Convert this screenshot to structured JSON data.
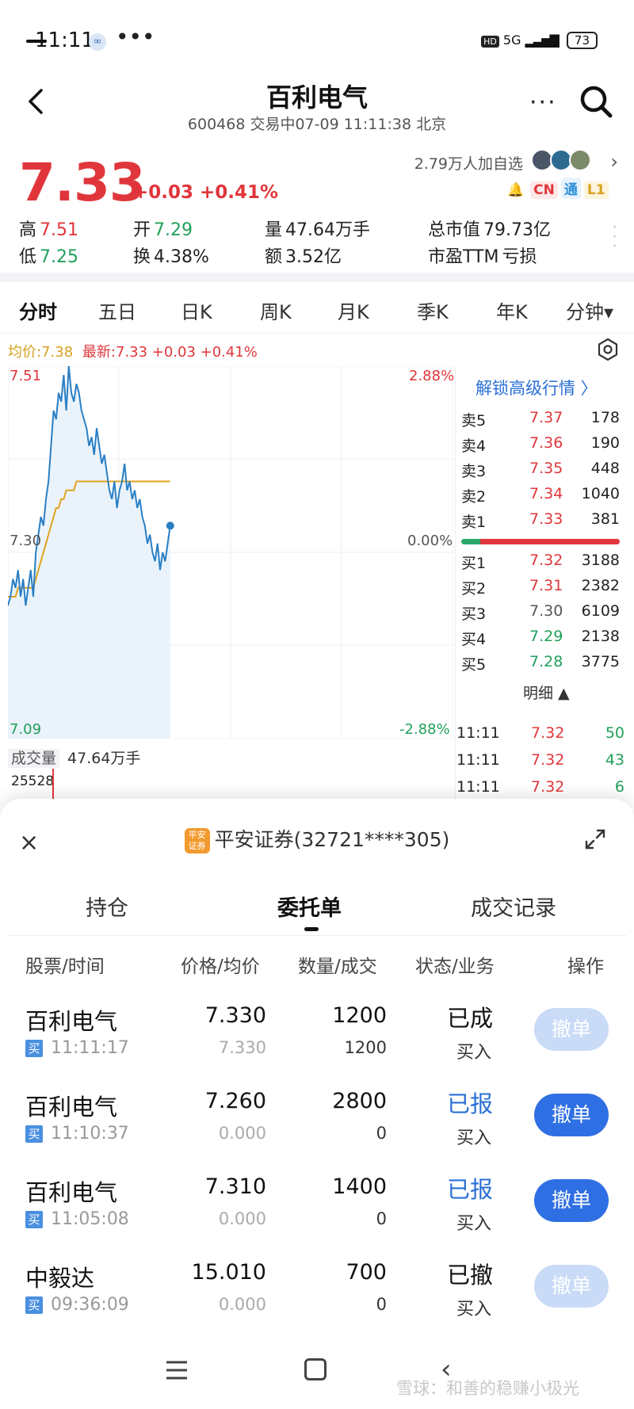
{
  "status_bar": {
    "time": "11:11",
    "more": "•••",
    "network": "5G",
    "battery": "73"
  },
  "header": {
    "title": "百利电气",
    "subtitle": "600468 交易中07-09 11:11:38 北京",
    "more_label": "···"
  },
  "quote": {
    "price": "7.33",
    "change": "+0.03 +0.41%",
    "followers": "2.79万人加自选",
    "tags": [
      "CN",
      "通",
      "L1"
    ],
    "stats": [
      {
        "label": "高",
        "value": "7.51",
        "color": "red"
      },
      {
        "label": "开",
        "value": "7.29",
        "color": "green"
      },
      {
        "label": "量",
        "value": "47.64万手",
        "color": "plain"
      },
      {
        "label": "总市值",
        "value": "79.73亿",
        "color": "plain"
      },
      {
        "label": "低",
        "value": "7.25",
        "color": "green"
      },
      {
        "label": "换",
        "value": "4.38%",
        "color": "plain"
      },
      {
        "label": "额",
        "value": "3.52亿",
        "color": "plain"
      },
      {
        "label": "市盈TTM",
        "value": "亏损",
        "color": "plain"
      }
    ]
  },
  "kline_tabs": [
    "分时",
    "五日",
    "日K",
    "周K",
    "月K",
    "季K",
    "年K",
    "分钟▾"
  ],
  "chart": {
    "avg_label": "均价:7.38",
    "latest_label": "最新:7.33 +0.03 +0.41%",
    "y_high": "7.51",
    "y_mid": "7.30",
    "y_low": "7.09",
    "pct_high": "2.88%",
    "pct_mid": "0.00%",
    "pct_low": "-2.88%",
    "volume_label": "成交量",
    "volume_value": "47.64万手",
    "volume_max": "25528"
  },
  "chart_data": {
    "type": "line",
    "series": [
      {
        "values": [
          7.24,
          7.25,
          7.27,
          7.26,
          7.28,
          7.25,
          7.27,
          7.24,
          7.26,
          7.28,
          7.25,
          7.3,
          7.32,
          7.34,
          7.33,
          7.36,
          7.38,
          7.42,
          7.46,
          7.45,
          7.48,
          7.47,
          7.5,
          7.46,
          7.51,
          7.48,
          7.47,
          7.49,
          7.48,
          7.46,
          7.45,
          7.44,
          7.42,
          7.43,
          7.41,
          7.44,
          7.42,
          7.4,
          7.41,
          7.39,
          7.37,
          7.36,
          7.38,
          7.35,
          7.37,
          7.38,
          7.4,
          7.37,
          7.38,
          7.36,
          7.37,
          7.35,
          7.36,
          7.34,
          7.33,
          7.31,
          7.32,
          7.3,
          7.29,
          7.31,
          7.28,
          7.3,
          7.29,
          7.31,
          7.33
        ]
      },
      {
        "values": [
          7.25,
          7.25,
          7.25,
          7.25,
          7.26,
          7.26,
          7.26,
          7.26,
          7.26,
          7.26,
          7.26,
          7.27,
          7.28,
          7.29,
          7.3,
          7.31,
          7.32,
          7.33,
          7.34,
          7.35,
          7.35,
          7.36,
          7.36,
          7.37,
          7.37,
          7.37,
          7.37,
          7.38,
          7.38,
          7.38,
          7.38,
          7.38,
          7.38,
          7.38,
          7.38,
          7.38,
          7.38,
          7.38,
          7.38,
          7.38,
          7.38,
          7.38,
          7.38,
          7.38,
          7.38,
          7.38,
          7.38,
          7.38,
          7.38,
          7.38,
          7.38,
          7.38,
          7.38,
          7.38,
          7.38,
          7.38,
          7.38,
          7.38,
          7.38,
          7.38,
          7.38,
          7.38,
          7.38,
          7.38,
          7.38
        ]
      }
    ],
    "ylim": [
      7.09,
      7.51
    ],
    "grid": true
  },
  "orderbook": {
    "unlock": "解锁高级行情 〉",
    "asks": [
      {
        "label": "卖5",
        "price": "7.37",
        "qty": "178",
        "color": "red"
      },
      {
        "label": "卖4",
        "price": "7.36",
        "qty": "190",
        "color": "red"
      },
      {
        "label": "卖3",
        "price": "7.35",
        "qty": "448",
        "color": "red"
      },
      {
        "label": "卖2",
        "price": "7.34",
        "qty": "1040",
        "color": "red"
      },
      {
        "label": "卖1",
        "price": "7.33",
        "qty": "381",
        "color": "red"
      }
    ],
    "bids": [
      {
        "label": "买1",
        "price": "7.32",
        "qty": "3188",
        "color": "red"
      },
      {
        "label": "买2",
        "price": "7.31",
        "qty": "2382",
        "color": "red"
      },
      {
        "label": "买3",
        "price": "7.30",
        "qty": "6109",
        "color": "gray"
      },
      {
        "label": "买4",
        "price": "7.29",
        "qty": "2138",
        "color": "green"
      },
      {
        "label": "买5",
        "price": "7.28",
        "qty": "3775",
        "color": "green"
      }
    ],
    "mingxi": "明细 ▲",
    "ticks": [
      {
        "time": "11:11",
        "price": "7.32",
        "qty": "50",
        "color": "green"
      },
      {
        "time": "11:11",
        "price": "7.32",
        "qty": "43",
        "color": "green"
      },
      {
        "time": "11:11",
        "price": "7.32",
        "qty": "6",
        "color": "green"
      }
    ]
  },
  "sheet": {
    "close": "×",
    "broker_logo": "平安证券",
    "broker": "平安证券(32721****305)",
    "tabs": [
      "持仓",
      "委托单",
      "成交记录"
    ],
    "columns": [
      "股票/时间",
      "价格/均价",
      "数量/成交",
      "状态/业务",
      "操作"
    ],
    "orders": [
      {
        "name": "百利电气",
        "side": "买",
        "time": "11:11:17",
        "price": "7.330",
        "avg": "7.330",
        "qty": "1200",
        "filled": "1200",
        "status": "已成",
        "status_style": "plain",
        "biz": "买入",
        "action": "撤单",
        "enabled": false
      },
      {
        "name": "百利电气",
        "side": "买",
        "time": "11:10:37",
        "price": "7.260",
        "avg": "0.000",
        "qty": "2800",
        "filled": "0",
        "status": "已报",
        "status_style": "blue",
        "biz": "买入",
        "action": "撤单",
        "enabled": true
      },
      {
        "name": "百利电气",
        "side": "买",
        "time": "11:05:08",
        "price": "7.310",
        "avg": "0.000",
        "qty": "1400",
        "filled": "0",
        "status": "已报",
        "status_style": "blue",
        "biz": "买入",
        "action": "撤单",
        "enabled": true
      },
      {
        "name": "中毅达",
        "side": "买",
        "time": "09:36:09",
        "price": "15.010",
        "avg": "0.000",
        "qty": "700",
        "filled": "0",
        "status": "已撤",
        "status_style": "plain",
        "biz": "买入",
        "action": "撤单",
        "enabled": false
      }
    ]
  },
  "watermark": "雪球：和善的稳赚小极光"
}
